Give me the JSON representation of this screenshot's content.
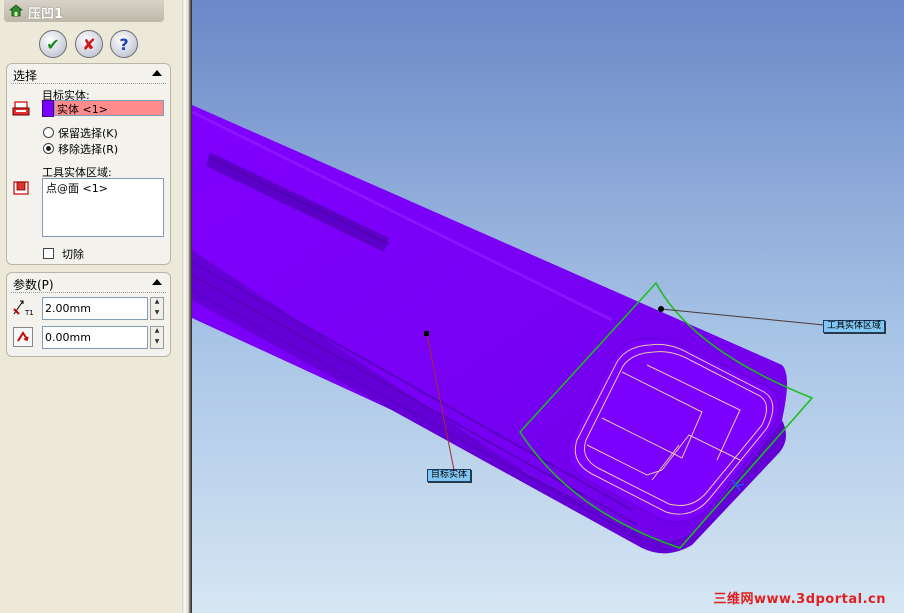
{
  "feature": {
    "title": "压凹1"
  },
  "buttons": {
    "ok": "✔",
    "cancel": "✘",
    "help": "?"
  },
  "selection_group": {
    "title": "选择",
    "target_body_label": "目标实体:",
    "target_body_value": "实体 <1>",
    "keep_selection": "保留选择(K)",
    "remove_selection": "移除选择(R)",
    "tool_region_label": "工具实体区域:",
    "tool_region_value": "点@面 <1>",
    "cut_label": "切除"
  },
  "parameters_group": {
    "title": "参数(P)",
    "thickness": "2.00mm",
    "clearance": "0.00mm"
  },
  "viewport": {
    "callout_tool_region": "工具实体区域",
    "callout_target_body": "目标实体"
  },
  "watermark": "三维网www.3dportal.cn",
  "colors": {
    "body": "#7a00ff",
    "selection_highlight": "#ff8c8c",
    "tool_outline": "#18c018",
    "callout_bg": "#7fc6f2"
  }
}
